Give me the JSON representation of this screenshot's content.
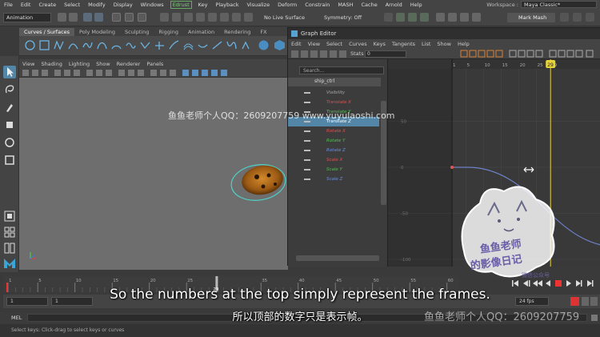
{
  "menubar": {
    "items": [
      "File",
      "Edit",
      "Create",
      "Select",
      "Modify",
      "Display",
      "Windows",
      "Edrust",
      "Key",
      "Playback",
      "Visualize",
      "Deform",
      "Constrain",
      "MASH",
      "Cache",
      "Arnold",
      "Help"
    ],
    "highlighted_index": 7,
    "workspace_label": "Workspace :",
    "workspace_value": "Maya Classic*"
  },
  "statusline": {
    "mode": "Animation",
    "live_surface": "No Live Surface",
    "symmetry": "Symmetry: Off",
    "mark_button": "Mark Mash"
  },
  "shelf": {
    "tabs": [
      "Curves / Surfaces",
      "Poly Modeling",
      "Sculpting",
      "Rigging",
      "Animation",
      "Rendering",
      "FX"
    ],
    "active_tab_index": 0
  },
  "viewport": {
    "menu": [
      "View",
      "Shading",
      "Lighting",
      "Show",
      "Renderer",
      "Panels"
    ]
  },
  "graph_editor": {
    "title": "Graph Editor",
    "menu": [
      "Edit",
      "View",
      "Select",
      "Curves",
      "Keys",
      "Tangents",
      "List",
      "Show",
      "Help"
    ],
    "stats_label": "Stats",
    "stats_value": "0",
    "search_placeholder": "Search...",
    "outliner": {
      "object": "ship_ctrl",
      "channels": [
        {
          "label": "Visibility",
          "color": "#aaaaaa",
          "selected": false
        },
        {
          "label": "Translate X",
          "color": "#e05050",
          "selected": false
        },
        {
          "label": "Translate Y",
          "color": "#50c050",
          "selected": false
        },
        {
          "label": "Translate Z",
          "color": "#ffffff",
          "selected": true
        },
        {
          "label": "Rotate X",
          "color": "#e05050",
          "selected": false
        },
        {
          "label": "Rotate Y",
          "color": "#50c050",
          "selected": false
        },
        {
          "label": "Rotate Z",
          "color": "#6a8fe0",
          "selected": false
        },
        {
          "label": "Scale X",
          "color": "#e05050",
          "selected": false
        },
        {
          "label": "Scale Y",
          "color": "#50c050",
          "selected": false
        },
        {
          "label": "Scale Z",
          "color": "#6a8fe0",
          "selected": false
        }
      ]
    },
    "graph": {
      "frame_ticks": [
        "1",
        "5",
        "10",
        "15",
        "20",
        "25",
        "29"
      ],
      "current_frame": "29",
      "value_ticks": [
        "50",
        "0",
        "-50",
        "-100"
      ]
    }
  },
  "timeline": {
    "ticks": [
      "1",
      "5",
      "10",
      "15",
      "20",
      "25",
      "29",
      "35",
      "40",
      "45",
      "50",
      "55",
      "60"
    ],
    "current_frame": "29",
    "range_start": "1",
    "range_inner_start": "1",
    "fps": "24 fps"
  },
  "mel": {
    "label": "MEL"
  },
  "helpline": "Select keys: Click-drag to select keys or curves",
  "overlay": {
    "watermark": "鱼鱼老师个人QQ：2609207759  www.yuyulaoshi.com",
    "watermark2": "鱼鱼老师个人QQ：2609207759",
    "subtitle_en": "So the numbers at the top simply represent the frames.",
    "subtitle_zh": "所以顶部的数字只是表示帧。",
    "stamp_text": "鱼鱼老师的影像日记",
    "stamp_sub": "微信公众号"
  }
}
